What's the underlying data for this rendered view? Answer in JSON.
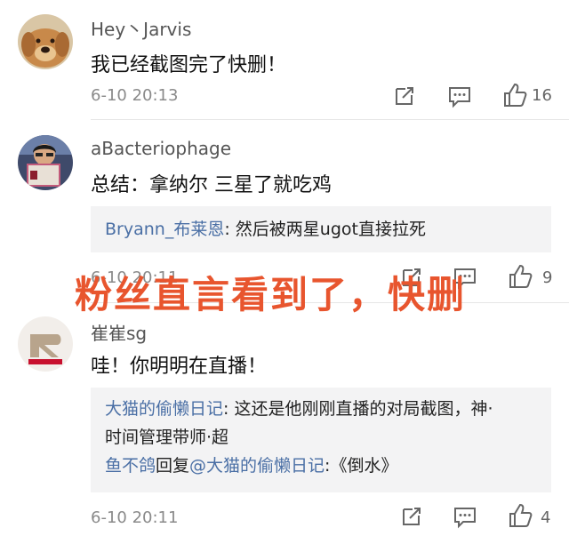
{
  "comments": [
    {
      "username": "Hey丶Jarvis",
      "text": "我已经截图完了快删！",
      "time": "6-10 20:13",
      "likes": "16",
      "avatar_icon": "golden-retriever-dog-avatar"
    },
    {
      "username": "aBacteriophage",
      "text": "总结：拿纳尔 三星了就吃鸡",
      "time": "6-10 20:11",
      "likes": "9",
      "avatar_icon": "person-reading-book-avatar",
      "replies": [
        {
          "user": "Bryann_布莱恩",
          "sep": ": ",
          "text": "然后被两星ugot直接拉死"
        }
      ]
    },
    {
      "username": "崔崔sg",
      "text": "哇！你明明在直播！",
      "time": "6-10 20:11",
      "likes": "4",
      "avatar_icon": "rng-logo-avatar",
      "replies": [
        {
          "user": "大猫的偷懒日记",
          "sep": ": ",
          "text": "这还是他刚刚直播的对局截图，神·",
          "text2": "时间管理带师·超"
        },
        {
          "user": "鱼不鸽",
          "mid": "回复",
          "user2": "@大猫的偷懒日记",
          "sep": ":",
          "text": "《倒水》"
        }
      ]
    }
  ],
  "overlay_text": "粉丝直言看到了，快删",
  "colors": {
    "overlay": "#e8552e",
    "reply_user": "#4a6fa5",
    "reply_bg": "#f3f3f4"
  }
}
